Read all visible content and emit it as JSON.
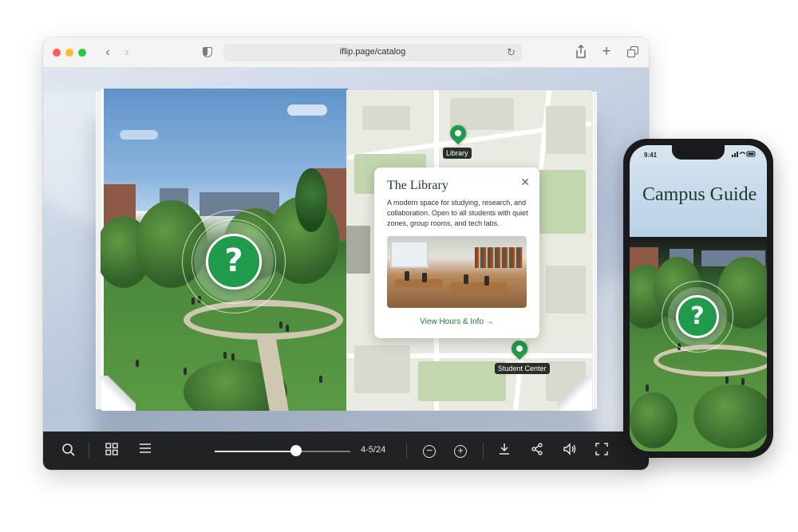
{
  "browser": {
    "url": "iflip.page/catalog",
    "nav": {
      "back_glyph": "‹",
      "forward_glyph": "›"
    },
    "icons": [
      "privacy-shield-icon",
      "reload-icon",
      "share-icon",
      "new-tab-icon",
      "tab-overview-icon"
    ]
  },
  "book": {
    "left_page": {
      "hotspot_glyph": "?"
    },
    "right_page": {
      "pins": [
        {
          "label": "Library"
        },
        {
          "label": "Student Center"
        }
      ],
      "popup": {
        "title": "The Library",
        "body": "A modern space for studying, research, and collaboration. Open to all students with quiet zones, group rooms, and tech labs.",
        "link": "View Hours & Info →",
        "close_glyph": "✕"
      }
    }
  },
  "toolbar": {
    "page_count": "4-5/24",
    "slider_progress": 0.6,
    "icons": [
      "search-icon",
      "thumbnails-icon",
      "table-of-contents-icon",
      "zoom-out-icon",
      "zoom-in-icon",
      "download-icon",
      "share-icon",
      "sound-icon",
      "fullscreen-icon"
    ]
  },
  "phone": {
    "time": "9:41",
    "title": "Campus Guide",
    "hotspot_glyph": "?"
  },
  "colors": {
    "accent_green": "#1f9b4b",
    "toolbar_bg": "#202224",
    "title_green": "#1e3a2a"
  }
}
